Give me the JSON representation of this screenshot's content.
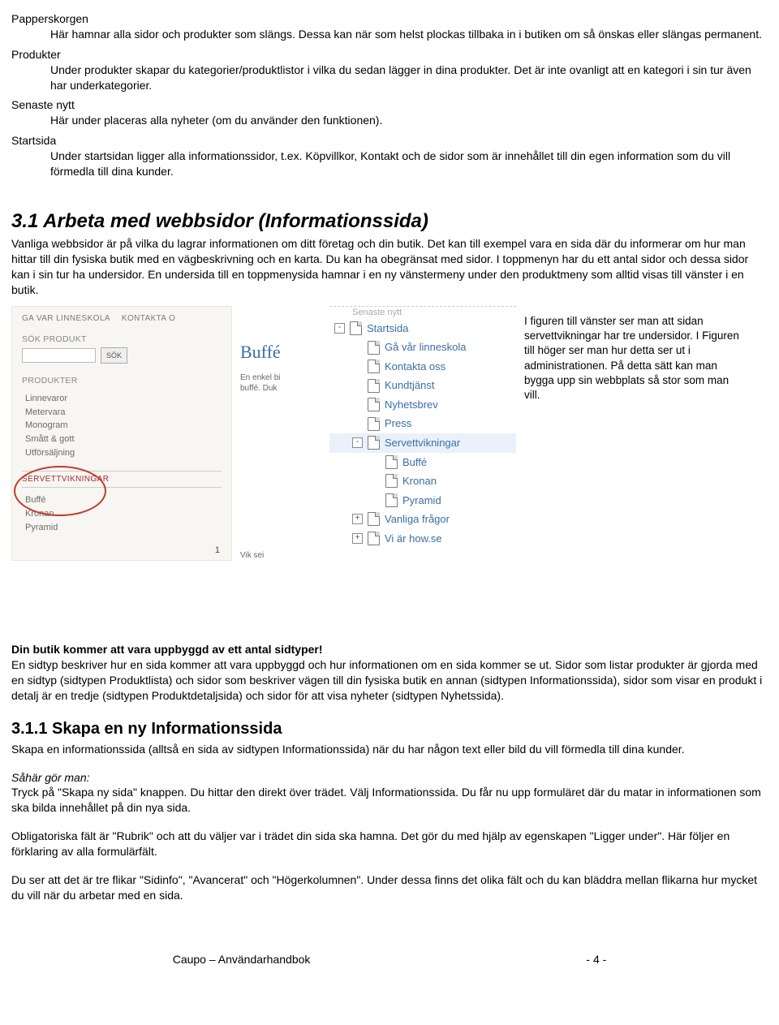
{
  "definitions": [
    {
      "term": "Papperskorgen",
      "def": "Här hamnar alla sidor och produkter som slängs. Dessa kan när som helst plockas tillbaka in i butiken om så önskas eller slängas permanent."
    },
    {
      "term": "Produkter",
      "def": "Under produkter skapar du kategorier/produktlistor i vilka du sedan lägger in dina produkter. Det är inte ovanligt att en kategori i sin tur även har underkategorier."
    },
    {
      "term": "Senaste nytt",
      "def": "Här under placeras alla nyheter (om du använder den funktionen)."
    },
    {
      "term": "Startsida",
      "def": "Under startsidan ligger alla informationssidor, t.ex. Köpvillkor, Kontakt och de sidor som är innehållet till din egen information som du vill förmedla till dina kunder."
    }
  ],
  "section31": {
    "heading": "3.1  Arbeta med webbsidor (Informationssida)",
    "body": "Vanliga webbsidor är på vilka du lagrar informationen om ditt företag och din butik. Det kan till exempel vara en sida där du informerar om hur man hittar till din fysiska butik med en vägbeskrivning och en karta. Du kan ha obegränsat med sidor. I toppmenyn har du ett antal sidor och dessa sidor kan i sin tur ha undersidor. En undersida till en toppmenysida hamnar i en ny vänstermeny under den produktmeny som alltid visas till vänster i en butik."
  },
  "frontend_figure": {
    "topnav": [
      "GA VAR LINNESKOLA",
      "KONTAKTA O"
    ],
    "search_label": "SÖK PRODUKT",
    "search_button": "SÖK",
    "products_label": "PRODUKTER",
    "products": [
      "Linnevaror",
      "Metervara",
      "Monogram",
      "Smått & gott",
      "Utförsäljning"
    ],
    "servett_label": "SERVETTVIKNINGAR",
    "servett": [
      "Buffé",
      "Kronan",
      "Pyramid"
    ],
    "page_num": "1"
  },
  "strip": {
    "title": "Buffé",
    "line1": "En enkel bi",
    "line2": "buffé. Duk",
    "bottom": "Vik sei"
  },
  "tree": {
    "top_cut": "Senaste nytt",
    "nodes": [
      {
        "level": 1,
        "toggle": "-",
        "label": "Startsida"
      },
      {
        "level": 2,
        "toggle": "",
        "label": "Gå vår linneskola"
      },
      {
        "level": 2,
        "toggle": "",
        "label": "Kontakta oss"
      },
      {
        "level": 2,
        "toggle": "",
        "label": "Kundtjänst"
      },
      {
        "level": 2,
        "toggle": "",
        "label": "Nyhetsbrev"
      },
      {
        "level": 2,
        "toggle": "",
        "label": "Press"
      },
      {
        "level": 2,
        "toggle": "-",
        "label": "Servettvikningar",
        "active": true
      },
      {
        "level": 3,
        "toggle": "",
        "label": "Buffé"
      },
      {
        "level": 3,
        "toggle": "",
        "label": "Kronan"
      },
      {
        "level": 3,
        "toggle": "",
        "label": "Pyramid"
      },
      {
        "level": 2,
        "toggle": "+",
        "label": "Vanliga frågor"
      },
      {
        "level": 2,
        "toggle": "+",
        "label": "Vi är how.se"
      }
    ]
  },
  "caption": "I figuren till vänster ser man att sidan servettvikningar har tre undersidor. I Figuren till höger ser man hur detta ser ut i administrationen. På detta sätt kan man bygga upp sin webbplats så stor som man vill.",
  "sidtyper_heading": "Din butik kommer att vara uppbyggd av ett antal sidtyper!",
  "sidtyper_body": "En sidtyp beskriver hur en sida kommer att vara uppbyggd och hur informationen om en sida kommer se ut. Sidor som listar produkter är gjorda med en sidtyp (sidtypen Produktlista) och sidor som beskriver vägen till din fysiska butik en annan (sidtypen Informationssida), sidor som visar en produkt i detalj är en tredje (sidtypen Produktdetaljsida) och sidor för att visa nyheter (sidtypen Nyhetssida).",
  "section311": {
    "heading": "3.1.1  Skapa en ny Informationssida",
    "body": "Skapa en informationssida (alltså en sida av sidtypen Informationssida) när du har någon text eller bild du vill förmedla till dina kunder.",
    "howto_label": "Såhär gör man:",
    "howto_body": "Tryck på \"Skapa ny sida\" knappen. Du hittar den direkt över trädet. Välj Informationssida. Du får nu upp formuläret där du matar in informationen som ska bilda innehållet på din nya sida.",
    "p3": "Obligatoriska fält är \"Rubrik\" och att du väljer var i trädet din sida ska hamna. Det gör du med hjälp av egenskapen \"Ligger under\". Här följer en förklaring av alla formulärfält.",
    "p4": "Du ser att det är tre flikar \"Sidinfo\", \"Avancerat\" och \"Högerkolumnen\". Under dessa finns det olika fält och du kan bläddra mellan flikarna hur mycket du vill när du arbetar med en sida."
  },
  "footer": {
    "left": "Caupo – Användarhandbok",
    "right": "- 4 -"
  }
}
